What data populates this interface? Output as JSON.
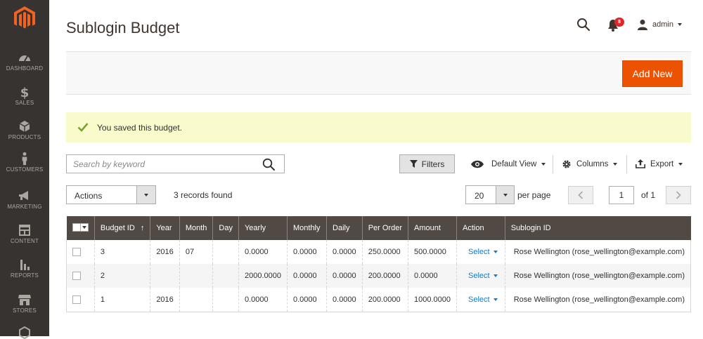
{
  "sidebar": {
    "items": [
      {
        "label": "DASHBOARD",
        "icon": "dashboard-icon"
      },
      {
        "label": "SALES",
        "icon": "dollar-icon"
      },
      {
        "label": "PRODUCTS",
        "icon": "cube-icon"
      },
      {
        "label": "CUSTOMERS",
        "icon": "person-icon"
      },
      {
        "label": "MARKETING",
        "icon": "megaphone-icon"
      },
      {
        "label": "CONTENT",
        "icon": "layout-icon"
      },
      {
        "label": "REPORTS",
        "icon": "bar-chart-icon"
      },
      {
        "label": "STORES",
        "icon": "storefront-icon"
      }
    ]
  },
  "header": {
    "title": "Sublogin Budget",
    "notifications_count": "8",
    "user_name": "admin"
  },
  "page_actions": {
    "add_new_label": "Add New"
  },
  "message": {
    "text": "You saved this budget."
  },
  "toolbar": {
    "search_placeholder": "Search by keyword",
    "filters_label": "Filters",
    "view_label": "Default View",
    "columns_label": "Columns",
    "export_label": "Export",
    "actions_label": "Actions",
    "records_found": "3 records found",
    "per_page_value": "20",
    "per_page_label": "per page",
    "current_page": "1",
    "page_of": "of 1"
  },
  "grid": {
    "columns": [
      "Budget ID",
      "Year",
      "Month",
      "Day",
      "Yearly",
      "Monthly",
      "Daily",
      "Per Order",
      "Amount",
      "Action",
      "Sublogin ID"
    ],
    "sorted_column": "Budget ID",
    "action_label": "Select",
    "rows": [
      {
        "id": "3",
        "year": "2016",
        "month": "07",
        "day": "",
        "yearly": "0.0000",
        "monthly": "0.0000",
        "daily": "0.0000",
        "per_order": "250.0000",
        "amount": "500.0000",
        "sublogin": "Rose Wellington (rose_wellington@example.com)"
      },
      {
        "id": "2",
        "year": "",
        "month": "",
        "day": "",
        "yearly": "2000.0000",
        "monthly": "0.0000",
        "daily": "0.0000",
        "per_order": "200.0000",
        "amount": "0.0000",
        "sublogin": "Rose Wellington (rose_wellington@example.com)"
      },
      {
        "id": "1",
        "year": "2016",
        "month": "",
        "day": "",
        "yearly": "0.0000",
        "monthly": "0.0000",
        "daily": "0.0000",
        "per_order": "200.0000",
        "amount": "1000.0000",
        "sublogin": "Rose Wellington (rose_wellington@example.com)"
      }
    ]
  },
  "colors": {
    "sidebar_bg": "#373330",
    "accent": "#eb5202",
    "grid_header": "#514943",
    "link": "#1979c3",
    "success_bg": "#fafbcd",
    "success_check": "#79a22e"
  }
}
